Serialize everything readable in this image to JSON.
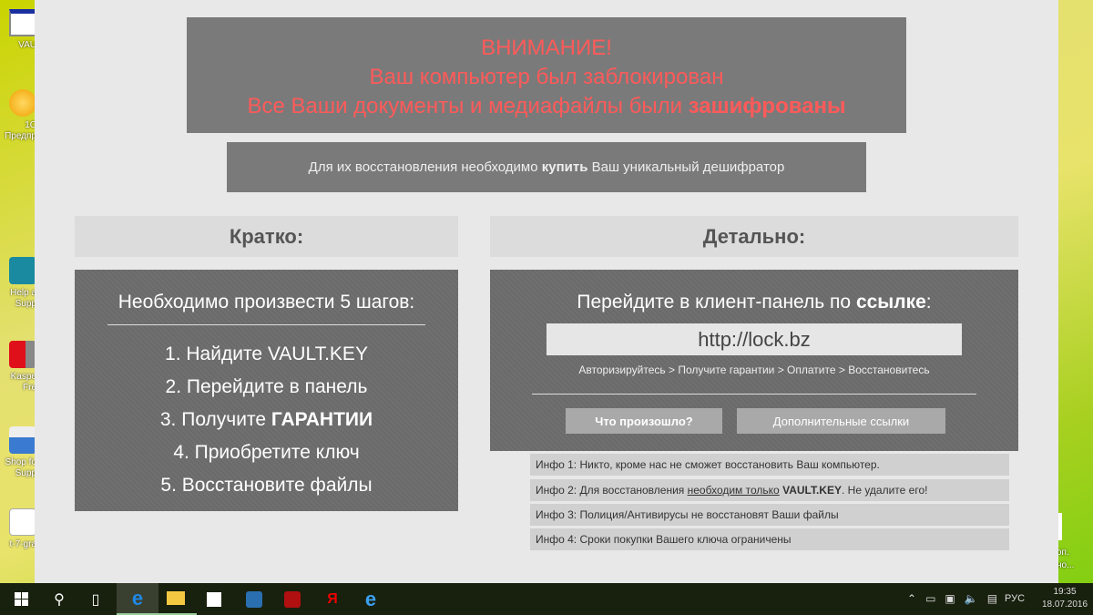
{
  "desktop": {
    "icons": [
      {
        "label1": "VAU",
        "label2": ""
      },
      {
        "label1": "1С",
        "label2": "Предпр"
      },
      {
        "label1": "Help a",
        "label2": "Supp"
      },
      {
        "label1": "Kaspe",
        "label2": "Fre"
      },
      {
        "label1": "Shop fo",
        "label2": "Supp"
      },
      {
        "label1": "t-7-gra",
        "label2": ""
      }
    ],
    "right_text": [
      "оп.",
      "но..."
    ]
  },
  "header": {
    "line1": "ВНИМАНИЕ!",
    "line2": "Ваш компьютер был заблокирован",
    "line3_pre": "Все Ваши документы и медиафайлы были ",
    "line3_bold": "зашифрованы"
  },
  "sub": {
    "pre": "Для их восстановления необходимо ",
    "bold": "купить",
    "post": " Ваш уникальный дешифратор"
  },
  "left": {
    "heading": "Кратко:",
    "intro": "Необходимо произвести 5 шагов:",
    "steps": [
      "1. Найдите VAULT.KEY",
      "2. Перейдите в панель",
      "3. Получите ",
      "4. Приобретите ключ",
      "5. Восстановите файлы"
    ],
    "step3_bold": "ГАРАНТИИ"
  },
  "right": {
    "heading": "Детально:",
    "intro_pre": "Перейдите в клиент-панель по ",
    "intro_bold": "ссылке",
    "intro_post": ":",
    "url": "http://lock.bz",
    "steps": "Авторизируйтесь > Получите гарантии > Оплатите > Восстановитесь",
    "btn1": "Что произошло?",
    "btn2": "Дополнительные ссылки"
  },
  "info": {
    "i1": "Инфо 1: Никто, кроме нас не сможет восстановить Ваш компьютер.",
    "i2_pre": "Инфо 2: Для восстановления ",
    "i2_u": "необходим только",
    "i2_sp": " ",
    "i2_b": "VAULT.KEY",
    "i2_post": ". Не удалите его!",
    "i3": "Инфо 3: Полиция/Антивирусы не восстановят Ваши файлы",
    "i4": "Инфо 4: Сроки покупки Вашего ключа ограничены"
  },
  "taskbar": {
    "lang": "РУС",
    "time": "19:35",
    "date": "18.07.2016"
  },
  "colors": {
    "alert": "#ff5a5a",
    "panel": "#6d6d6d"
  }
}
